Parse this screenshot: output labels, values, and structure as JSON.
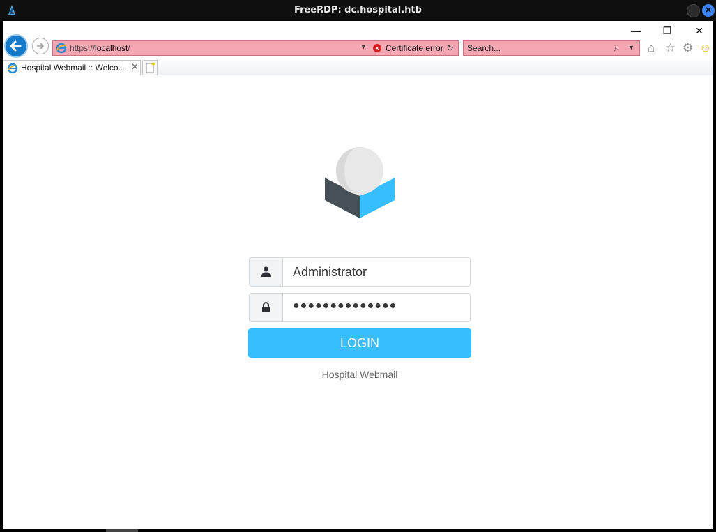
{
  "rdp": {
    "title": "FreeRDP: dc.hospital.htb"
  },
  "browser": {
    "window_controls": {
      "minimize": "—",
      "restore": "❐",
      "close": "✕"
    },
    "address": {
      "scheme": "https://",
      "host": "localhost",
      "path": "/"
    },
    "certificate": {
      "label": "Certificate error"
    },
    "search": {
      "placeholder": "Search..."
    },
    "tabs": [
      {
        "label": "Hospital Webmail :: Welco..."
      }
    ],
    "icons": [
      "home-icon",
      "favorites-icon",
      "settings-icon",
      "feedback-smiley-icon"
    ]
  },
  "login": {
    "username": "Administrator",
    "password_mask": "●●●●●●●●●●●●●●",
    "button_label": "LOGIN",
    "footer": "Hospital Webmail"
  },
  "colors": {
    "accent": "#37beff",
    "address_bar_error": "#f4a7b3",
    "ie_back": "#1479c9",
    "logo_dark": "#465057",
    "logo_blue": "#37beff"
  }
}
